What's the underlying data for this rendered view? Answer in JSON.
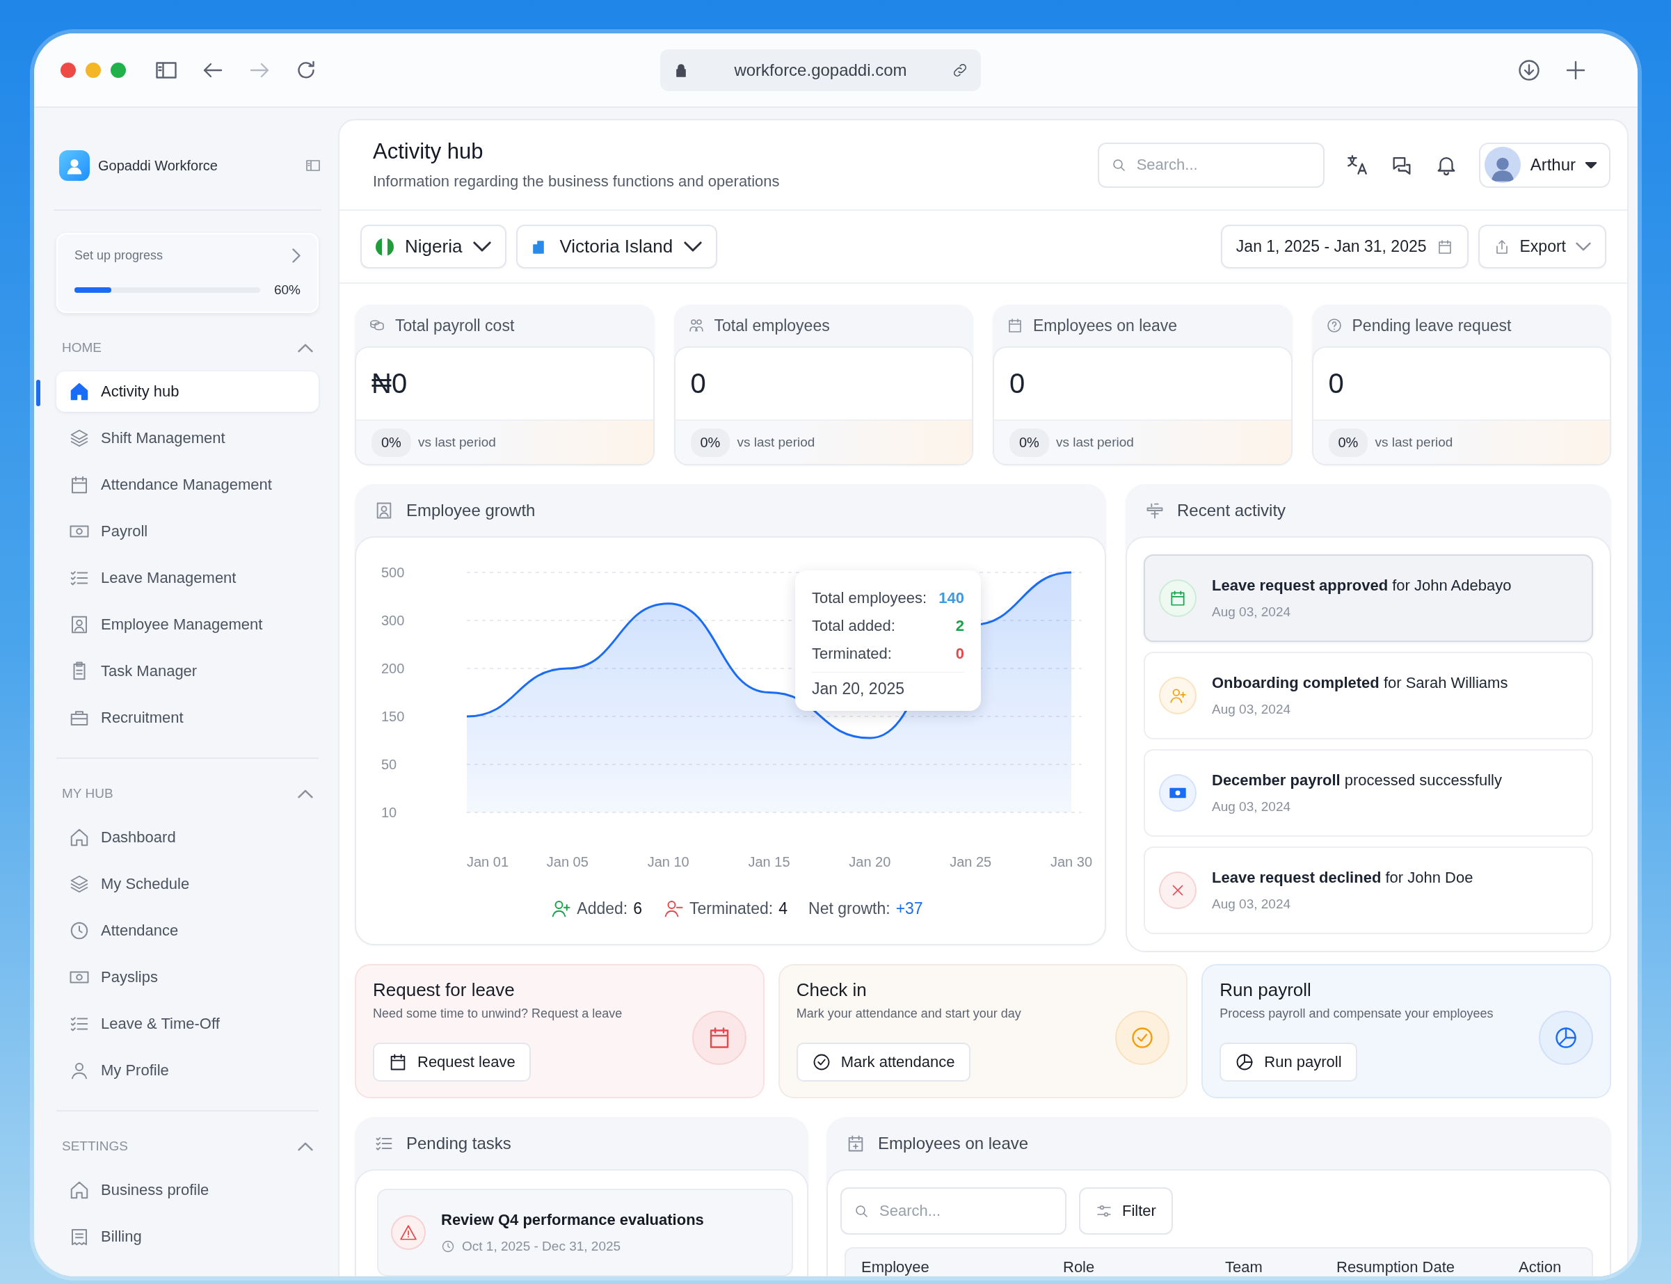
{
  "browser": {
    "url": "workforce.gopaddi.com"
  },
  "sidebar": {
    "brand": "Gopaddi Workforce",
    "setup": {
      "label": "Set up progress",
      "level": 0.2,
      "reading": "60%"
    },
    "sections": [
      {
        "title": "HOME",
        "expanded": true,
        "items": [
          {
            "label": "Activity hub",
            "kind": "home",
            "selected": true
          },
          {
            "label": "Shift Management",
            "kind": "layers",
            "selected": false
          },
          {
            "label": "Attendance Management",
            "kind": "calendar",
            "selected": false
          },
          {
            "label": "Payroll",
            "kind": "money",
            "selected": false
          },
          {
            "label": "Leave Management",
            "kind": "checklist",
            "selected": false
          },
          {
            "label": "Employee Management",
            "kind": "portrait",
            "selected": false
          },
          {
            "label": "Task Manager",
            "kind": "clipboard",
            "selected": false
          },
          {
            "label": "Recruitment",
            "kind": "briefcase",
            "selected": false
          }
        ]
      },
      {
        "title": "MY HUB",
        "expanded": true,
        "items": [
          {
            "label": "Dashboard",
            "kind": "home",
            "selected": false
          },
          {
            "label": "My Schedule",
            "kind": "layers",
            "selected": false
          },
          {
            "label": "Attendance",
            "kind": "clock",
            "selected": false
          },
          {
            "label": "Payslips",
            "kind": "money",
            "selected": false
          },
          {
            "label": "Leave & Time-Off",
            "kind": "checklist",
            "selected": false
          },
          {
            "label": "My Profile",
            "kind": "user",
            "selected": false
          }
        ]
      },
      {
        "title": "SETTINGS",
        "expanded": true,
        "items": [
          {
            "label": "Business profile",
            "kind": "home",
            "selected": false
          },
          {
            "label": "Billing",
            "kind": "receipt",
            "selected": false
          }
        ]
      }
    ]
  },
  "header": {
    "title": "Activity hub",
    "subtitle": "Information regarding the business functions and operations",
    "search": {
      "placeholder": "Search..."
    },
    "user": {
      "name": "Arthur"
    }
  },
  "filters": {
    "country": "Nigeria",
    "location": "Victoria Island",
    "date_range": "Jan 1, 2025 - Jan 31, 2025",
    "export": "Export"
  },
  "stats": [
    {
      "kind": "payroll",
      "title": "Total payroll cost",
      "value": "₦0",
      "change": "0%",
      "note": "vs last period"
    },
    {
      "kind": "employees",
      "title": "Total employees",
      "value": "0",
      "change": "0%",
      "note": "vs last period"
    },
    {
      "kind": "leave",
      "title": "Employees on leave",
      "value": "0",
      "change": "0%",
      "note": "vs last period"
    },
    {
      "kind": "pending",
      "title": "Pending leave request",
      "value": "0",
      "change": "0%",
      "note": "vs last period"
    }
  ],
  "growth": {
    "title": "Employee growth",
    "y_axis_labels": [
      "500",
      "300",
      "200",
      "150",
      "50",
      "10"
    ],
    "x_axis_labels": [
      "Jan 01",
      "Jan 05",
      "Jan 10",
      "Jan 15",
      "Jan 20",
      "Jan 25",
      "Jan 30"
    ],
    "tooltip": {
      "rows": [
        {
          "label": "Total employees:",
          "value": "140",
          "color": "#3b9ae1"
        },
        {
          "label": "Total added:",
          "value": "2",
          "color": "#16a34a"
        },
        {
          "label": "Terminated:",
          "value": "0",
          "color": "#e5484d"
        }
      ],
      "date": "Jan 20, 2025"
    },
    "legend": [
      {
        "kind": "added",
        "label": "Added:",
        "value": "6"
      },
      {
        "kind": "terminated",
        "label": "Terminated:",
        "value": "4"
      },
      {
        "kind": "net",
        "label": "Net growth:",
        "value": "+37"
      }
    ]
  },
  "recent_activity": {
    "title": "Recent activity",
    "items": [
      {
        "kind": "approved",
        "text": "**Leave request approved** for John Adebayo",
        "date": "Aug 03, 2024",
        "selected": true
      },
      {
        "kind": "onboarding",
        "text": "**Onboarding completed** for Sarah Williams",
        "date": "Aug 03, 2024",
        "selected": false
      },
      {
        "kind": "payroll",
        "text": "**December payroll** processed successfully",
        "date": "Aug 03, 2024",
        "selected": false
      },
      {
        "kind": "declined",
        "text": "**Leave request declined** for John Doe",
        "date": "Aug 03, 2024",
        "selected": false
      }
    ]
  },
  "actions": [
    {
      "kind": "leave",
      "title": "Request for leave",
      "description": "Need some time to unwind? Request a leave",
      "button": "Request leave"
    },
    {
      "kind": "checkin",
      "title": "Check in",
      "description": "Mark your attendance and start your day",
      "button": "Mark attendance"
    },
    {
      "kind": "payroll",
      "title": "Run payroll",
      "description": "Process payroll and compensate your employees",
      "button": "Run payroll"
    }
  ],
  "pending_tasks": {
    "title": "Pending tasks",
    "items": [
      {
        "title": "Review Q4 performance evaluations",
        "dates": "Oct 1, 2025 - Dec 31, 2025"
      }
    ]
  },
  "employees_on_leave": {
    "title": "Employees on leave",
    "search": {
      "placeholder": "Search..."
    },
    "filter": "Filter",
    "columns": [
      "Employee",
      "Role",
      "Team",
      "Resumption Date",
      "Action"
    ]
  }
}
